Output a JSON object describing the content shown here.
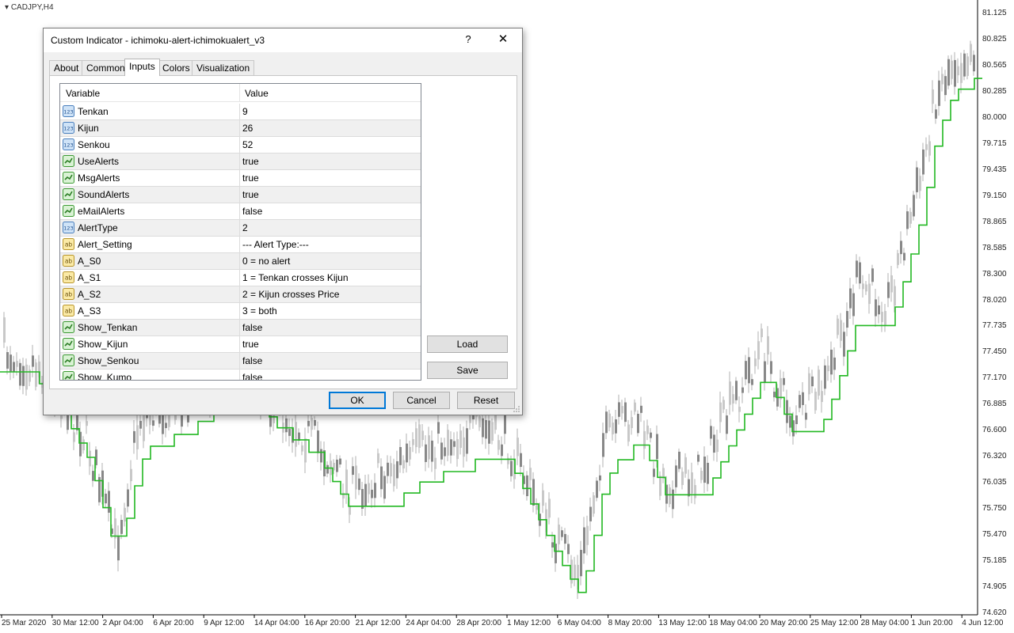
{
  "chart": {
    "symbol": "CADJPY,H4",
    "price_labels": [
      "81.125",
      "80.825",
      "80.565",
      "80.285",
      "80.000",
      "79.715",
      "79.435",
      "79.150",
      "78.865",
      "78.585",
      "78.300",
      "78.020",
      "77.735",
      "77.450",
      "77.170",
      "76.885",
      "76.600",
      "76.320",
      "76.035",
      "75.750",
      "75.470",
      "75.185",
      "74.905",
      "74.620"
    ],
    "time_labels": [
      "25 Mar 2020",
      "30 Mar 12:00",
      "2 Apr 04:00",
      "6 Apr 20:00",
      "9 Apr 12:00",
      "14 Apr 04:00",
      "16 Apr 20:00",
      "21 Apr 12:00",
      "24 Apr 04:00",
      "28 Apr 20:00",
      "1 May 12:00",
      "6 May 04:00",
      "8 May 20:00",
      "13 May 12:00",
      "18 May 04:00",
      "20 May 20:00",
      "25 May 12:00",
      "28 May 04:00",
      "1 Jun 20:00",
      "4 Jun 12:00"
    ],
    "colors": {
      "candle": "#888888",
      "kijun": "#22b822",
      "axis": "#000000"
    }
  },
  "dialog": {
    "title": "Custom Indicator - ichimoku-alert-ichimokualert_v3",
    "help": "?",
    "close": "✕",
    "tabs": [
      "About",
      "Common",
      "Inputs",
      "Colors",
      "Visualization"
    ],
    "active_tab": "Inputs",
    "grid": {
      "headers": {
        "variable": "Variable",
        "value": "Value"
      },
      "rows": [
        {
          "icon": "int",
          "name": "Tenkan",
          "value": "9"
        },
        {
          "icon": "int",
          "name": "Kijun",
          "value": "26"
        },
        {
          "icon": "int",
          "name": "Senkou",
          "value": "52"
        },
        {
          "icon": "bool",
          "name": "UseAlerts",
          "value": "true"
        },
        {
          "icon": "bool",
          "name": "MsgAlerts",
          "value": "true"
        },
        {
          "icon": "bool",
          "name": "SoundAlerts",
          "value": "true"
        },
        {
          "icon": "bool",
          "name": "eMailAlerts",
          "value": "false"
        },
        {
          "icon": "int",
          "name": "AlertType",
          "value": "2"
        },
        {
          "icon": "str",
          "name": "Alert_Setting",
          "value": "--- Alert Type:---"
        },
        {
          "icon": "str",
          "name": "A_S0",
          "value": "0 = no alert"
        },
        {
          "icon": "str",
          "name": "A_S1",
          "value": "1 = Tenkan crosses Kijun"
        },
        {
          "icon": "str",
          "name": "A_S2",
          "value": "2 = Kijun crosses Price"
        },
        {
          "icon": "str",
          "name": "A_S3",
          "value": "3 = both"
        },
        {
          "icon": "bool",
          "name": "Show_Tenkan",
          "value": "false"
        },
        {
          "icon": "bool",
          "name": "Show_Kijun",
          "value": "true"
        },
        {
          "icon": "bool",
          "name": "Show_Senkou",
          "value": "false"
        },
        {
          "icon": "bool",
          "name": "Show_Kumo",
          "value": "false"
        }
      ]
    },
    "buttons": {
      "load": "Load",
      "save": "Save",
      "ok": "OK",
      "cancel": "Cancel",
      "reset": "Reset"
    }
  }
}
